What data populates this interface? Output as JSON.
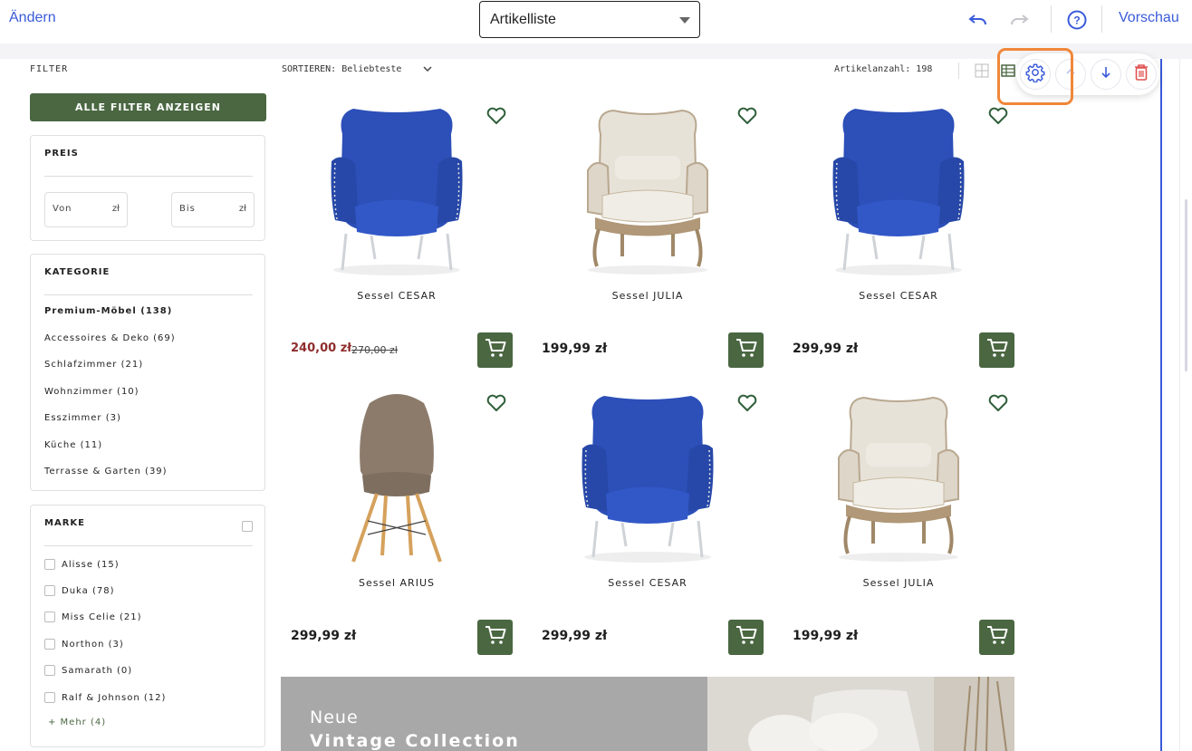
{
  "topbar": {
    "edit_label": "Ändern",
    "page_select_value": "Artikelliste",
    "preview_label": "Vorschau",
    "icons": [
      "undo-icon",
      "redo-icon",
      "help-icon"
    ],
    "accent": "#3a5bd9"
  },
  "sidebar": {
    "filter_title": "FILTER",
    "all_filters_button": "ALLE FILTER ANZEIGEN",
    "price": {
      "title": "PREIS",
      "from_placeholder": "Von",
      "to_placeholder": "Bis",
      "currency": "zł"
    },
    "category": {
      "title": "KATEGORIE",
      "items": [
        {
          "label": "Premium-Möbel (138)",
          "active": true
        },
        {
          "label": "Accessoires & Deko (69)",
          "active": false
        },
        {
          "label": "Schlafzimmer (21)",
          "active": false
        },
        {
          "label": "Wohnzimmer (10)",
          "active": false
        },
        {
          "label": "Esszimmer (3)",
          "active": false
        },
        {
          "label": "Küche (11)",
          "active": false
        },
        {
          "label": "Terrasse & Garten (39)",
          "active": false
        }
      ]
    },
    "brand": {
      "title": "MARKE",
      "items": [
        {
          "label": "Alisse (15)"
        },
        {
          "label": "Duka (78)"
        },
        {
          "label": "Miss Celie (21)"
        },
        {
          "label": "Northon (3)"
        },
        {
          "label": "Samarath (0)"
        },
        {
          "label": "Ralf & Johnson (12)"
        }
      ],
      "more_label": "+ Mehr (4)"
    }
  },
  "listing": {
    "sort_label": "SORTIEREN: Beliebteste",
    "count_label": "Artikelanzahl: 198",
    "brand_color": "#4a6741",
    "sale_color": "#8e2d2d",
    "products": [
      {
        "name": "Sessel CESAR",
        "price": "240,00 zł",
        "old_price": "270,00 zł",
        "type": "blue-chair"
      },
      {
        "name": "Sessel JULIA",
        "price": "199,99 zł",
        "old_price": "",
        "type": "wing-chair"
      },
      {
        "name": "Sessel CESAR",
        "price": "299,99 zł",
        "old_price": "",
        "type": "blue-chair"
      },
      {
        "name": "Sessel ARIUS",
        "price": "299,99 zł",
        "old_price": "",
        "type": "shell-chair"
      },
      {
        "name": "Sessel CESAR",
        "price": "299,99 zł",
        "old_price": "",
        "type": "blue-chair"
      },
      {
        "name": "Sessel JULIA",
        "price": "199,99 zł",
        "old_price": "",
        "type": "wing-chair"
      }
    ]
  },
  "banner": {
    "line1": "Neue",
    "line2": "Vintage Collection"
  },
  "editor_toolbar": {
    "icons": [
      "gear-icon",
      "arrow-up-icon",
      "arrow-down-icon",
      "trash-icon"
    ],
    "highlight_color": "#f0873a"
  }
}
